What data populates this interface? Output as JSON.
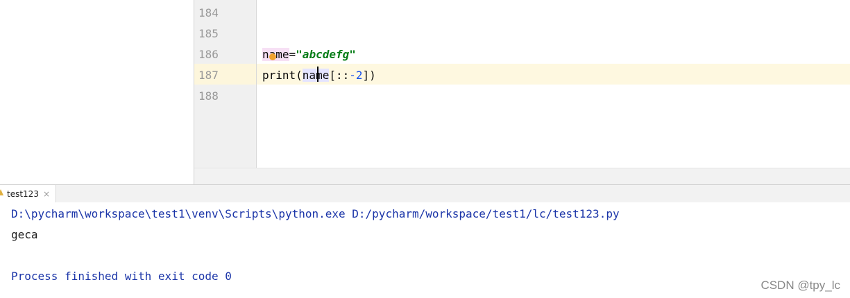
{
  "editor": {
    "line_numbers": [
      "184",
      "185",
      "186",
      "187",
      "188"
    ],
    "lines": {
      "l186": {
        "var": "name",
        "op": "=",
        "str": "\"abcdefg\""
      },
      "l187": {
        "func": "print(",
        "var": "name",
        "rest_a": "[::",
        "neg": "-2",
        "rest_b": "])"
      }
    }
  },
  "run_tab": {
    "label": "test123",
    "close": "×"
  },
  "console": {
    "command": "D:\\pycharm\\workspace\\test1\\venv\\Scripts\\python.exe D:/pycharm/workspace/test1/lc/test123.py",
    "output": "geca",
    "exit_message": "Process finished with exit code 0"
  },
  "watermark": "CSDN @tpy_lc",
  "colors": {
    "string": "#067d17",
    "number": "#1750eb",
    "console_blue": "#1a34a8",
    "current_line": "#fef8e0"
  },
  "icons": [
    "intention-bulb-icon",
    "python-file-icon",
    "close-icon"
  ]
}
